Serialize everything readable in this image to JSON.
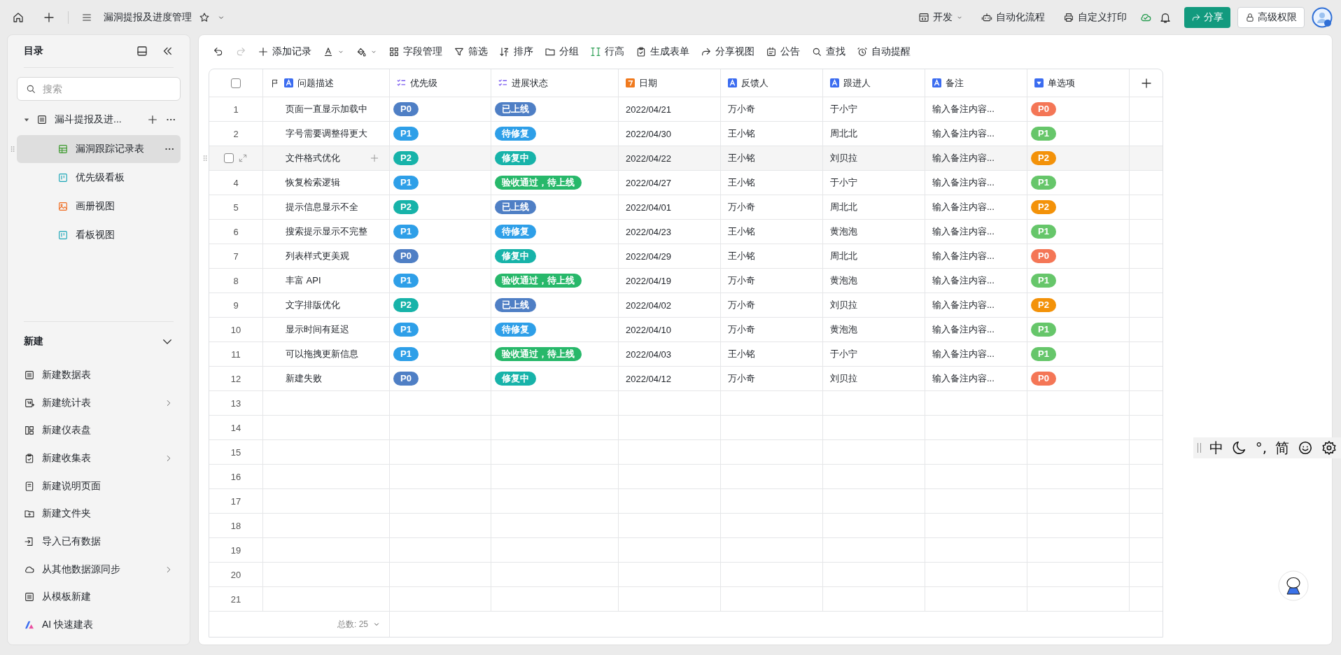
{
  "top_bar": {
    "title": "漏洞提报及进度管理",
    "actions": [
      {
        "kind": "dev",
        "label": "开发",
        "caret": true
      },
      {
        "kind": "robot",
        "label": "自动化流程",
        "caret": false
      },
      {
        "kind": "printer",
        "label": "自定义打印",
        "caret": false
      }
    ],
    "share_button": "分享",
    "permission_button": "高级权限"
  },
  "sidebar": {
    "title": "目录",
    "search": {
      "placeholder": "搜索"
    },
    "tree": [
      {
        "label": "漏斗提报及进...",
        "kind": "list",
        "expanded": true,
        "selected": false,
        "children": [
          {
            "label": "漏洞跟踪记录表",
            "kind": "sheet",
            "selected": true
          },
          {
            "label": "优先级看板",
            "kind": "kanban",
            "selected": false
          },
          {
            "label": "画册视图",
            "kind": "gallery",
            "selected": false
          },
          {
            "label": "看板视图",
            "kind": "kanban",
            "selected": false
          }
        ]
      }
    ],
    "new_section": {
      "title": "新建",
      "expanded": true,
      "items": [
        {
          "label": "新建数据表",
          "kind": "list",
          "submenu": false
        },
        {
          "label": "新建统计表",
          "kind": "stats",
          "submenu": true
        },
        {
          "label": "新建仪表盘",
          "kind": "dashboard",
          "submenu": false
        },
        {
          "label": "新建收集表",
          "kind": "form",
          "submenu": true
        },
        {
          "label": "新建说明页面",
          "kind": "doc",
          "submenu": false
        },
        {
          "label": "新建文件夹",
          "kind": "newfolder",
          "submenu": false
        },
        {
          "label": "导入已有数据",
          "kind": "import",
          "submenu": false
        },
        {
          "label": "从其他数据源同步",
          "kind": "cloud",
          "submenu": true
        },
        {
          "label": "从模板新建",
          "kind": "list",
          "submenu": false
        },
        {
          "label": "AI 快速建表",
          "kind": "ai",
          "submenu": false
        }
      ]
    }
  },
  "toolbar": [
    {
      "kind": "undo",
      "disabled": false
    },
    {
      "kind": "redo",
      "disabled": true
    },
    {
      "kind": "plus",
      "label": "添加记录"
    },
    {
      "kind": "textcolor",
      "caret": true
    },
    {
      "kind": "fill",
      "caret": true
    },
    {
      "kind": "grid",
      "label": "字段管理"
    },
    {
      "kind": "filter",
      "label": "筛选"
    },
    {
      "kind": "sort",
      "label": "排序"
    },
    {
      "kind": "folder",
      "label": "分组"
    },
    {
      "kind": "rowheight",
      "label": "行高"
    },
    {
      "kind": "form",
      "label": "生成表单"
    },
    {
      "kind": "share",
      "label": "分享视图"
    },
    {
      "kind": "announce",
      "label": "公告"
    },
    {
      "kind": "search",
      "label": "查找"
    },
    {
      "kind": "reminder",
      "label": "自动提醒"
    }
  ],
  "table": {
    "all_checked": false,
    "columns": [
      {
        "label": "问题描述",
        "kind": "primary"
      },
      {
        "label": "优先级",
        "kind": "multi"
      },
      {
        "label": "进展状态",
        "kind": "multi"
      },
      {
        "label": "日期",
        "kind": "date"
      },
      {
        "label": "反馈人",
        "kind": "text"
      },
      {
        "label": "跟进人",
        "kind": "text"
      },
      {
        "label": "备注",
        "kind": "text"
      },
      {
        "label": "单选项",
        "kind": "single"
      }
    ],
    "rows": [
      {
        "number": "1",
        "hovered": false,
        "description": "页面一直显示加载中",
        "priority": {
          "text": "P0",
          "color": "#4f7fc5"
        },
        "status": {
          "text": "已上线",
          "color": "#4f7fc5"
        },
        "date": "2022/04/21",
        "reporter": "万小奇",
        "follower": "于小宁",
        "note": "输入备注内容...",
        "option": {
          "text": "P0",
          "color": "#f47656"
        }
      },
      {
        "number": "2",
        "hovered": false,
        "description": "字号需要调整得更大",
        "priority": {
          "text": "P1",
          "color": "#2e9fe8"
        },
        "status": {
          "text": "待修复",
          "color": "#2e9fe8"
        },
        "date": "2022/04/30",
        "reporter": "王小铭",
        "follower": "周北北",
        "note": "输入备注内容...",
        "option": {
          "text": "P1",
          "color": "#66c66a"
        }
      },
      {
        "hovered": true,
        "checked": false,
        "description": "文件格式优化",
        "priority": {
          "text": "P2",
          "color": "#17b3a9"
        },
        "status": {
          "text": "修复中",
          "color": "#17b3a9"
        },
        "date": "2022/04/22",
        "reporter": "王小铭",
        "follower": "刘贝拉",
        "note": "输入备注内容...",
        "option": {
          "text": "P2",
          "color": "#f39209"
        }
      },
      {
        "number": "4",
        "hovered": false,
        "description": "恢复检索逻辑",
        "priority": {
          "text": "P1",
          "color": "#2e9fe8"
        },
        "status": {
          "text": "验收通过，待上线",
          "color": "#27b86a"
        },
        "date": "2022/04/27",
        "reporter": "王小铭",
        "follower": "于小宁",
        "note": "输入备注内容...",
        "option": {
          "text": "P1",
          "color": "#66c66a"
        }
      },
      {
        "number": "5",
        "hovered": false,
        "description": "提示信息显示不全",
        "priority": {
          "text": "P2",
          "color": "#17b3a9"
        },
        "status": {
          "text": "已上线",
          "color": "#4f7fc5"
        },
        "date": "2022/04/01",
        "reporter": "万小奇",
        "follower": "周北北",
        "note": "输入备注内容...",
        "option": {
          "text": "P2",
          "color": "#f39209"
        }
      },
      {
        "number": "6",
        "hovered": false,
        "description": "搜索提示显示不完整",
        "priority": {
          "text": "P1",
          "color": "#2e9fe8"
        },
        "status": {
          "text": "待修复",
          "color": "#2e9fe8"
        },
        "date": "2022/04/23",
        "reporter": "王小铭",
        "follower": "黄泡泡",
        "note": "输入备注内容...",
        "option": {
          "text": "P1",
          "color": "#66c66a"
        }
      },
      {
        "number": "7",
        "hovered": false,
        "description": "列表样式更美观",
        "priority": {
          "text": "P0",
          "color": "#4f7fc5"
        },
        "status": {
          "text": "修复中",
          "color": "#17b3a9"
        },
        "date": "2022/04/29",
        "reporter": "王小铭",
        "follower": "周北北",
        "note": "输入备注内容...",
        "option": {
          "text": "P0",
          "color": "#f47656"
        }
      },
      {
        "number": "8",
        "hovered": false,
        "description": "丰富 API",
        "priority": {
          "text": "P1",
          "color": "#2e9fe8"
        },
        "status": {
          "text": "验收通过，待上线",
          "color": "#27b86a"
        },
        "date": "2022/04/19",
        "reporter": "万小奇",
        "follower": "黄泡泡",
        "note": "输入备注内容...",
        "option": {
          "text": "P1",
          "color": "#66c66a"
        }
      },
      {
        "number": "9",
        "hovered": false,
        "description": "文字排版优化",
        "priority": {
          "text": "P2",
          "color": "#17b3a9"
        },
        "status": {
          "text": "已上线",
          "color": "#4f7fc5"
        },
        "date": "2022/04/02",
        "reporter": "万小奇",
        "follower": "刘贝拉",
        "note": "输入备注内容...",
        "option": {
          "text": "P2",
          "color": "#f39209"
        }
      },
      {
        "number": "10",
        "hovered": false,
        "description": "显示时间有延迟",
        "priority": {
          "text": "P1",
          "color": "#2e9fe8"
        },
        "status": {
          "text": "待修复",
          "color": "#2e9fe8"
        },
        "date": "2022/04/10",
        "reporter": "万小奇",
        "follower": "黄泡泡",
        "note": "输入备注内容...",
        "option": {
          "text": "P1",
          "color": "#66c66a"
        }
      },
      {
        "number": "11",
        "hovered": false,
        "description": "可以拖拽更新信息",
        "priority": {
          "text": "P1",
          "color": "#2e9fe8"
        },
        "status": {
          "text": "验收通过，待上线",
          "color": "#27b86a"
        },
        "date": "2022/04/03",
        "reporter": "王小铭",
        "follower": "于小宁",
        "note": "输入备注内容...",
        "option": {
          "text": "P1",
          "color": "#66c66a"
        }
      },
      {
        "number": "12",
        "hovered": false,
        "description": "新建失败",
        "priority": {
          "text": "P0",
          "color": "#4f7fc5"
        },
        "status": {
          "text": "修复中",
          "color": "#17b3a9"
        },
        "date": "2022/04/12",
        "reporter": "万小奇",
        "follower": "刘贝拉",
        "note": "输入备注内容...",
        "option": {
          "text": "P0",
          "color": "#f47656"
        }
      },
      {
        "number": "13",
        "hovered": false
      },
      {
        "number": "14",
        "hovered": false
      },
      {
        "number": "15",
        "hovered": false
      },
      {
        "number": "16",
        "hovered": false
      },
      {
        "number": "17",
        "hovered": false
      },
      {
        "number": "18",
        "hovered": false
      },
      {
        "number": "19",
        "hovered": false
      },
      {
        "number": "20",
        "hovered": false
      },
      {
        "number": "21",
        "hovered": false
      }
    ],
    "footer_count": "总数: 25"
  },
  "ime_toolbar": [
    {
      "kind": "text",
      "text": "中"
    },
    {
      "kind": "moon"
    },
    {
      "kind": "text",
      "text": "°,"
    },
    {
      "kind": "text",
      "text": "简"
    },
    {
      "kind": "smiley"
    },
    {
      "kind": "gear"
    }
  ]
}
